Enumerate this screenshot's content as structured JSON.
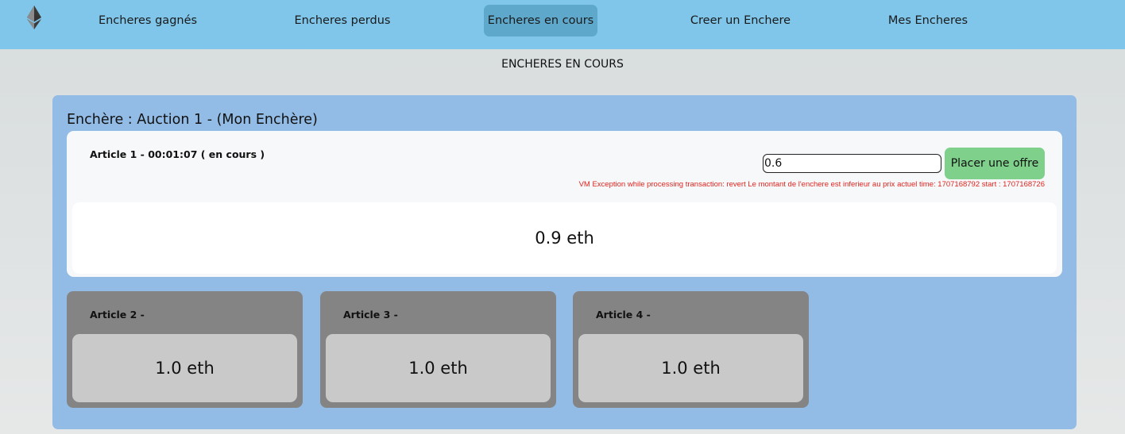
{
  "nav": {
    "logo_icon": "ethereum-icon",
    "items": [
      {
        "label": "Encheres gagnés",
        "active": false
      },
      {
        "label": "Encheres perdus",
        "active": false
      },
      {
        "label": "Encheres en cours",
        "active": true
      },
      {
        "label": "Creer un Enchere",
        "active": false
      },
      {
        "label": "Mes Encheres",
        "active": false
      }
    ]
  },
  "page": {
    "title": "ENCHERES EN COURS"
  },
  "auction": {
    "title": "Enchère : Auction 1 - (Mon Enchère)",
    "active_article": {
      "header": "Article 1 - 00:01:07 ( en cours )",
      "bid_input_value": "0.6",
      "bid_button_label": "Placer une offre",
      "error": "VM Exception while processing transaction: revert Le montant de l'enchere est inferieur au prix actuel time: 1707168792 start : 1707168726",
      "price": "0.9 eth"
    },
    "other_articles": [
      {
        "header": "Article 2 -",
        "price": "1.0 eth"
      },
      {
        "header": "Article 3 -",
        "price": "1.0 eth"
      },
      {
        "header": "Article 4 -",
        "price": "1.0 eth"
      }
    ]
  },
  "colors": {
    "navbar": "#7fc6ea",
    "nav_active": "#5ea8cc",
    "panel": "#92bce6",
    "bid_button": "#7ed08b",
    "error": "#e0241e",
    "inactive_card": "#848484"
  }
}
